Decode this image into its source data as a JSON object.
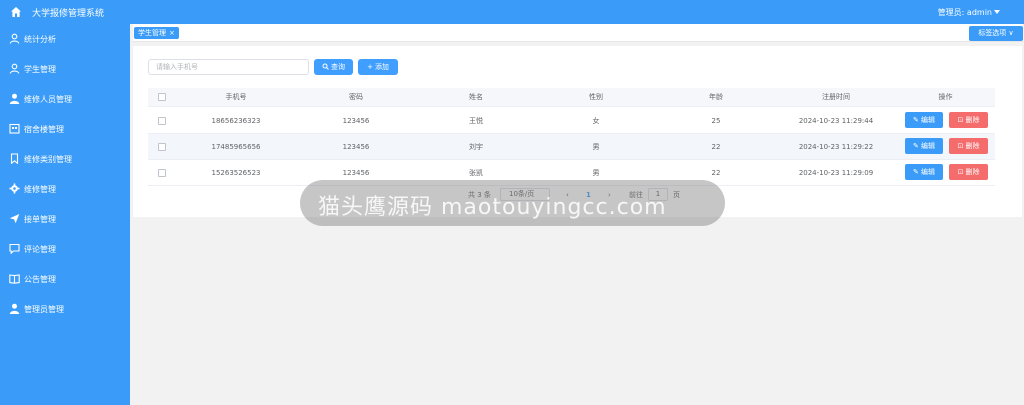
{
  "app": {
    "title": "大学报修管理系统",
    "admin_label": "管理员: admin",
    "home_icon": "home-icon"
  },
  "sidebar": {
    "items": [
      {
        "label": "统计分析",
        "icon": "user-outline-icon"
      },
      {
        "label": "学生管理",
        "icon": "user-outline-icon"
      },
      {
        "label": "维修人员管理",
        "icon": "user-filled-icon"
      },
      {
        "label": "宿舍楼管理",
        "icon": "building-icon"
      },
      {
        "label": "维修类别管理",
        "icon": "bookmark-icon"
      },
      {
        "label": "维修管理",
        "icon": "gear-icon"
      },
      {
        "label": "接单管理",
        "icon": "send-icon"
      },
      {
        "label": "评论管理",
        "icon": "comment-icon"
      },
      {
        "label": "公告管理",
        "icon": "book-icon"
      },
      {
        "label": "管理员管理",
        "icon": "user-filled-icon"
      }
    ]
  },
  "tabs": {
    "active": "学生管理",
    "close": "×",
    "options_label": "标签选项 ∨"
  },
  "search": {
    "placeholder": "请输入手机号",
    "query_label": "查询",
    "add_label": "添加"
  },
  "table": {
    "headers": [
      "手机号",
      "密码",
      "姓名",
      "性别",
      "年龄",
      "注册时间",
      "操作"
    ],
    "rows": [
      {
        "phone": "18656236323",
        "password": "123456",
        "name": "王悦",
        "gender": "女",
        "age": "25",
        "registered": "2024-10-23 11:29:44"
      },
      {
        "phone": "17485965656",
        "password": "123456",
        "name": "刘宇",
        "gender": "男",
        "age": "22",
        "registered": "2024-10-23 11:29:22"
      },
      {
        "phone": "15263526523",
        "password": "123456",
        "name": "张凯",
        "gender": "男",
        "age": "22",
        "registered": "2024-10-23 11:29:09"
      }
    ],
    "edit_label": "编辑",
    "delete_label": "删除"
  },
  "pagination": {
    "total": "共 3 条",
    "page_size": "10条/页",
    "current_page": "1",
    "goto_label": "前往",
    "goto_value": "1",
    "page_suffix": "页"
  },
  "watermark": "猫头鹰源码 maotouyingcc.com",
  "colors": {
    "primary": "#3a9cf8",
    "danger": "#f56c6c"
  }
}
